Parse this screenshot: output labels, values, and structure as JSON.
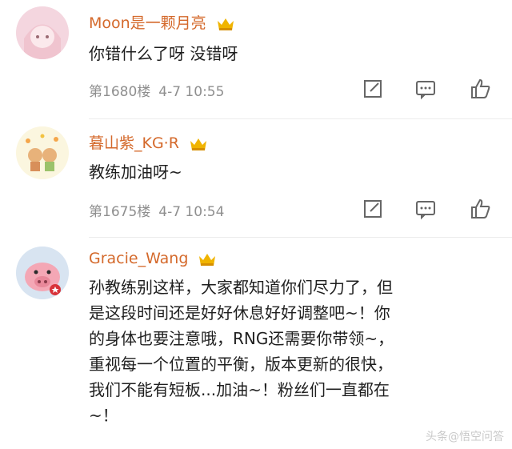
{
  "comments": [
    {
      "username": "Moon是一颗月亮",
      "text": "你错什么了呀 没错呀",
      "floor": "第1680楼",
      "time": "4-7 10:55"
    },
    {
      "username": "暮山紫_KG·R",
      "text": "教练加油呀~",
      "floor": "第1675楼",
      "time": "4-7 10:54"
    },
    {
      "username": "Gracie_Wang",
      "text_lines": [
        "孙教练别这样，大家都知道你们尽力了，但",
        "是这段时间还是好好休息好好调整吧~！你",
        "的身体也要注意哦，RNG还需要你带领~，",
        "重视每一个位置的平衡，版本更新的很快，",
        "我们不能有短板...加油~！粉丝们一直都在",
        "~！"
      ]
    }
  ],
  "colors": {
    "username": "#d4692b",
    "meta": "#8f8f8f",
    "badge": "#f0b400"
  },
  "watermark": "头条@悟空问答"
}
